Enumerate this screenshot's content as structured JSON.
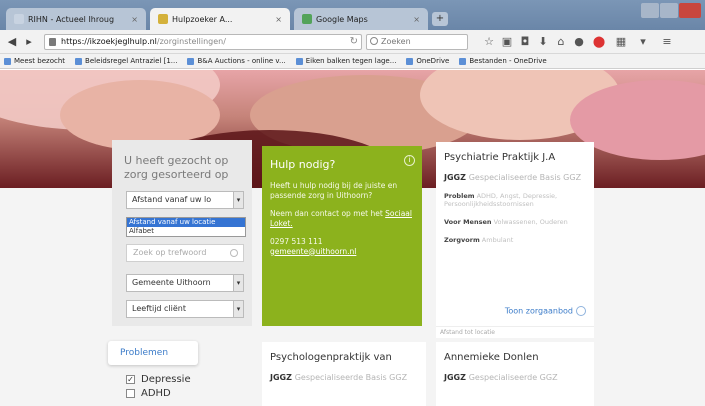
{
  "browser": {
    "tabs": [
      {
        "title": "RIHN - Actueel Ihroug",
        "active": false
      },
      {
        "title": "Hulpzoeker A...",
        "active": true
      },
      {
        "title": "Google Maps",
        "active": false
      }
    ],
    "url_host": "https://ikzoekjeglhulp.nl",
    "url_path": "/zorginstellingen/",
    "search_placeholder": "Zoeken",
    "bookmarks": [
      "Meest bezocht",
      "Beleidsregel Antraziel [1...",
      "B&A Auctions - online v...",
      "Eiken balken tegen lage...",
      "OneDrive",
      "Bestanden - OneDrive"
    ]
  },
  "sidebar": {
    "heading": "U heeft gezocht op zorg gesorteerd op",
    "sort_value": "Afstand vanaf uw lo",
    "dropdown_options": [
      "Afstand vanaf uw locatie",
      "Alfabet"
    ],
    "keyword_placeholder": "Zoek op trefwoord",
    "municipality": "Gemeente Uithoorn",
    "age": "Leeftijd cliënt"
  },
  "filters": {
    "label": "Problemen",
    "items": [
      {
        "label": "Depressie",
        "checked": true
      },
      {
        "label": "ADHD",
        "checked": false
      }
    ]
  },
  "help_card": {
    "title": "Hulp nodig?",
    "text1": "Heeft u hulp nodig bij de juiste en passende zorg in Uithoorn?",
    "text2_prefix": "Neem dan contact op met het",
    "text2_link": "Sociaal Loket.",
    "phone": "0297 513 111",
    "email": "gemeente@uithoorn.nl",
    "info_glyph": "i"
  },
  "results": [
    {
      "name": "Psychiatrie Praktijk J.A",
      "category": "JGGZ",
      "category_sub": "Gespecialiseerde Basis GGZ",
      "fields": [
        {
          "label": "Problem",
          "value": "ADHD, Angst, Depressie, Persoonlijkheidsstoornissen"
        },
        {
          "label": "Voor Mensen",
          "value": "Volwassenen, Ouderen"
        },
        {
          "label": "Zorgvorm",
          "value": "Ambulant"
        }
      ],
      "more": "Toon zorgaanbod",
      "footer": "Afstand tot locatie"
    },
    {
      "name": "Psychologenpraktijk van",
      "category": "JGGZ",
      "category_sub": "Gespecialiseerde Basis GGZ"
    },
    {
      "name": "Annemieke Donlen",
      "category": "JGGZ",
      "category_sub": "Gespecialiseerde GGZ"
    }
  ]
}
